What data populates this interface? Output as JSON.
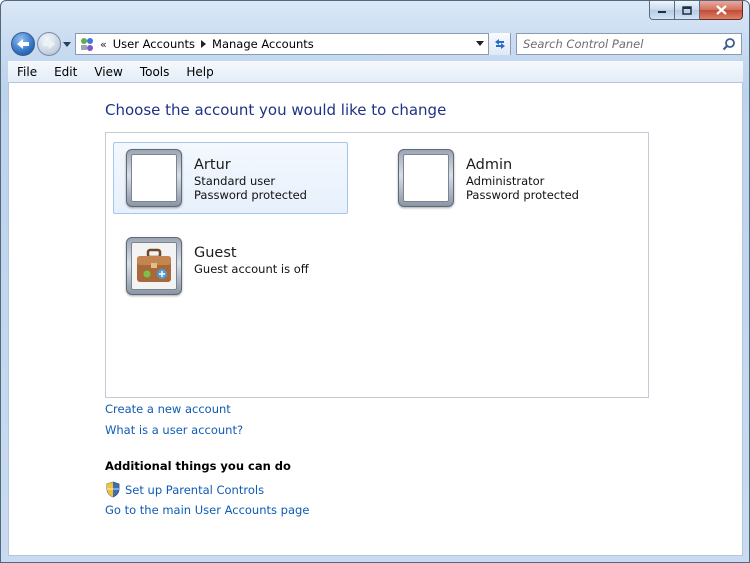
{
  "window": {
    "controls": [
      "minimize",
      "maximize",
      "close"
    ]
  },
  "address": {
    "chevrons": "«",
    "crumbs": [
      "User Accounts",
      "Manage Accounts"
    ]
  },
  "search": {
    "placeholder": "Search Control Panel"
  },
  "menu": [
    "File",
    "Edit",
    "View",
    "Tools",
    "Help"
  ],
  "main": {
    "heading": "Choose the account you would like to change",
    "accounts": [
      {
        "name": "Artur",
        "line1": "Standard user",
        "line2": "Password protected",
        "selected": true
      },
      {
        "name": "Admin",
        "line1": "Administrator",
        "line2": "Password protected",
        "selected": false
      },
      {
        "name": "Guest",
        "line1": "Guest account is off",
        "line2": "",
        "selected": false
      }
    ],
    "links": {
      "create": "Create a new account",
      "what": "What is a user account?"
    },
    "additional": {
      "heading": "Additional things you can do",
      "parental": "Set up Parental Controls",
      "main_page": "Go to the main User Accounts page"
    }
  },
  "icons": {
    "back": "back-arrow-icon",
    "forward": "forward-arrow-icon",
    "control_panel": "control-panel-icon",
    "refresh": "refresh-icon",
    "search": "search-icon",
    "shield": "shield-icon",
    "briefcase": "briefcase-icon"
  },
  "colors": {
    "heading": "#1e3287",
    "link": "#0f5bb5",
    "selection_border": "#a8c6e9"
  }
}
